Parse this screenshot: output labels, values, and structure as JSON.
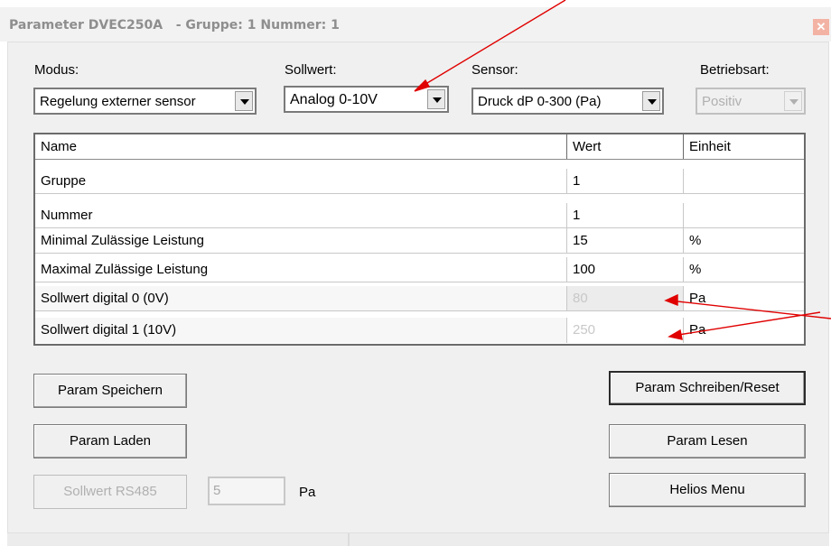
{
  "window": {
    "title": "Parameter DVEC250A   - Gruppe: 1 Nummer: 1",
    "close_glyph": "✕"
  },
  "selectors": {
    "modus_label": "Modus:",
    "modus_value": "Regelung externer sensor",
    "sollwert_label": "Sollwert:",
    "sollwert_value": "Analog 0-10V",
    "sensor_label": "Sensor:",
    "sensor_value": "Druck dP 0-300 (Pa)",
    "betriebsart_label": "Betriebsart:",
    "betriebsart_value": "Positiv"
  },
  "table": {
    "headers": [
      "Name",
      "Wert",
      "Einheit"
    ],
    "rows": [
      {
        "name": "Gruppe",
        "wert": "1",
        "einheit": "",
        "disabled": false
      },
      {
        "name": "Nummer",
        "wert": "1",
        "einheit": "",
        "disabled": false
      },
      {
        "name": "Minimal Zulässige Leistung",
        "wert": "15",
        "einheit": "%",
        "disabled": false
      },
      {
        "name": "Maximal Zulässige Leistung",
        "wert": "100",
        "einheit": "%",
        "disabled": false
      },
      {
        "name": "Sollwert digital 0 (0V)",
        "wert": "80",
        "einheit": "Pa",
        "disabled": true
      },
      {
        "name": "Sollwert digital 1 (10V)",
        "wert": "250",
        "einheit": "Pa",
        "disabled": true
      }
    ]
  },
  "buttons": {
    "param_speichern": "Param Speichern",
    "param_laden": "Param Laden",
    "sollwert_rs485": "Sollwert RS485",
    "param_schreiben_reset": "Param Schreiben/Reset",
    "param_lesen": "Param Lesen",
    "helios_menu": "Helios Menu"
  },
  "rs485": {
    "value": "5",
    "unit": "Pa"
  },
  "colors": {
    "annotation_arrow": "#e00000",
    "close_button": "#f3b3a4",
    "disabled_text": "#b0b0b0"
  }
}
